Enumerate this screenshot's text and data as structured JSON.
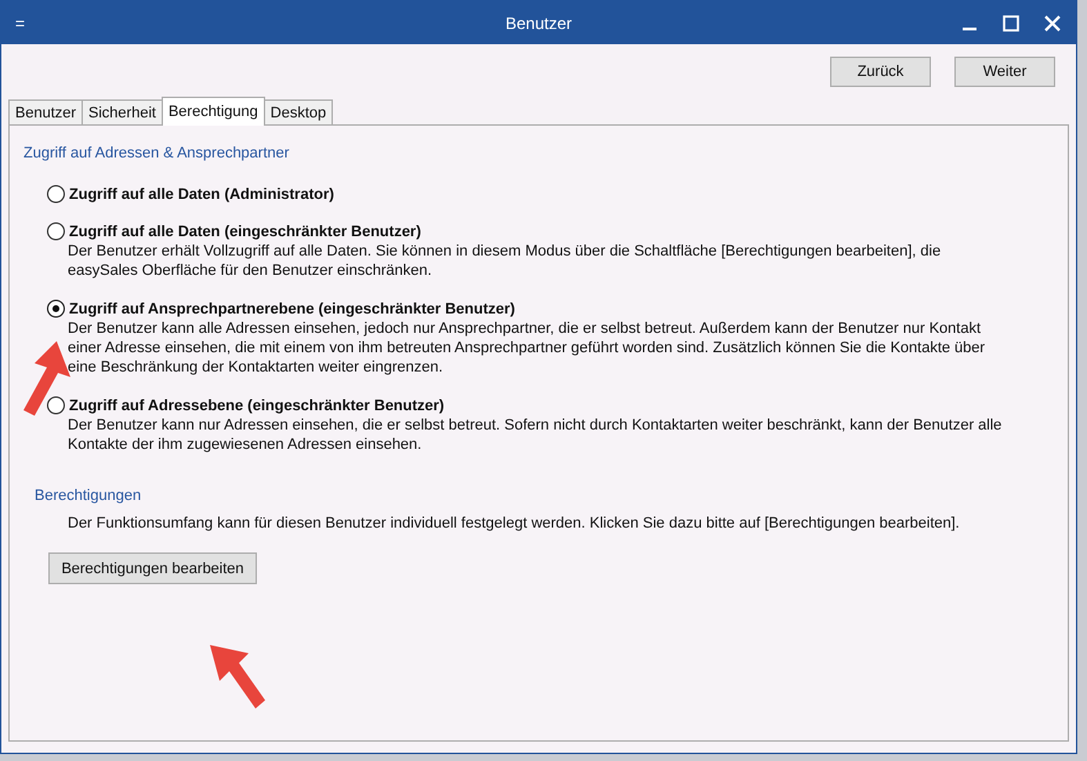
{
  "window": {
    "title": "Benutzer",
    "menu_glyph": "="
  },
  "buttons": [
    "Zurück",
    "Weiter"
  ],
  "tabs": [
    {
      "label": "Benutzer",
      "selected": false
    },
    {
      "label": "Sicherheit",
      "selected": false
    },
    {
      "label": "Berechtigung",
      "selected": true
    },
    {
      "label": "Desktop",
      "selected": false
    }
  ],
  "access_section": {
    "heading": "Zugriff auf Adressen & Ansprechpartner",
    "options": [
      {
        "label": "Zugriff auf alle Daten (Administrator)",
        "selected": false
      },
      {
        "label": "Zugriff auf alle Daten (eingeschränkter Benutzer)",
        "selected": false,
        "description": "Der Benutzer erhält Vollzugriff auf alle Daten. Sie können in diesem Modus über die Schaltfläche [Berechtigungen bearbeiten], die easySales Oberfläche für den Benutzer einschränken."
      },
      {
        "label": "Zugriff auf Ansprechpartnerebene (eingeschränkter Benutzer)",
        "selected": true,
        "description": "Der Benutzer kann alle Adressen einsehen, jedoch nur Ansprechpartner, die er selbst betreut. Außerdem kann der Benutzer nur Kontakt einer Adresse einsehen, die mit einem von ihm betreuten Ansprechpartner geführt worden sind. Zusätzlich können Sie die Kontakte über eine Beschränkung der Kontaktarten weiter eingrenzen."
      },
      {
        "label": "Zugriff auf Adressebene (eingeschränkter Benutzer)",
        "selected": false,
        "description": "Der Benutzer kann nur Adressen einsehen, die er selbst betreut. Sofern nicht durch Kontaktarten weiter beschränkt, kann der Benutzer alle Kontakte der ihm zugewiesenen Adressen einsehen."
      }
    ]
  },
  "permissions_section": {
    "heading": "Berechtigungen",
    "text": "Der Funktionsumfang kann für diesen Benutzer individuell festgelegt werden. Klicken Sie dazu bitte auf [Berechtigungen bearbeiten].",
    "button": "Berechtigungen bearbeiten"
  }
}
